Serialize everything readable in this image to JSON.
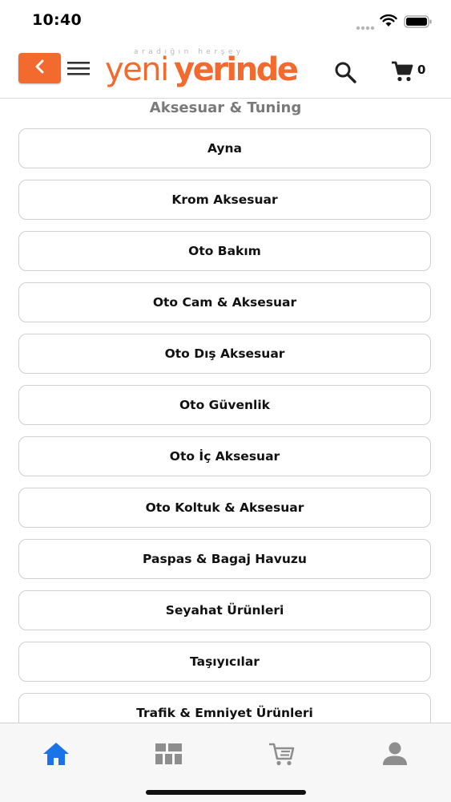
{
  "status_bar": {
    "time": "10:40"
  },
  "header": {
    "logo_tagline": "aradığın herşey",
    "logo_part1": "yeni",
    "logo_part2": "yerinde",
    "cart_count": "0"
  },
  "section": {
    "title": "Aksesuar & Tuning"
  },
  "categories": [
    {
      "label": "Ayna"
    },
    {
      "label": "Krom Aksesuar"
    },
    {
      "label": "Oto Bakım"
    },
    {
      "label": "Oto Cam & Aksesuar"
    },
    {
      "label": "Oto Dış Aksesuar"
    },
    {
      "label": "Oto Güvenlik"
    },
    {
      "label": "Oto İç Aksesuar"
    },
    {
      "label": "Oto Koltuk & Aksesuar"
    },
    {
      "label": "Paspas & Bagaj Havuzu"
    },
    {
      "label": "Seyahat Ürünleri"
    },
    {
      "label": "Taşıyıcılar"
    },
    {
      "label": "Trafik & Emniyet Ürünleri"
    }
  ],
  "tab_bar": {
    "tabs": [
      {
        "icon": "home-icon",
        "active": true
      },
      {
        "icon": "categories-icon",
        "active": false
      },
      {
        "icon": "cart-icon",
        "active": false
      },
      {
        "icon": "user-icon",
        "active": false
      }
    ]
  },
  "colors": {
    "brand": "#f26a2e",
    "active_tab": "#1a73e8",
    "inactive_tab": "#8e8e8e"
  }
}
